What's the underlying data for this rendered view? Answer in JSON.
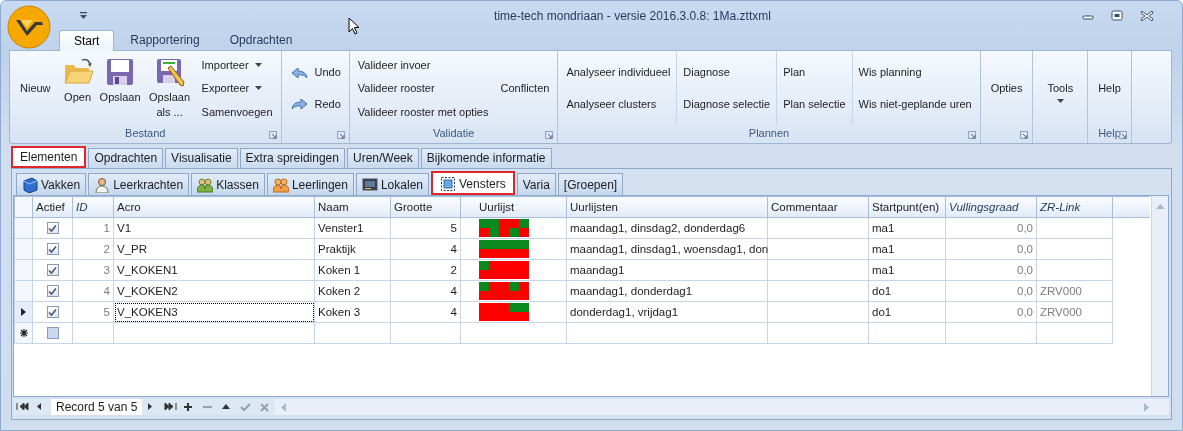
{
  "window": {
    "title": "time-tech mondriaan - versie 2016.3.0.8: 1Ma.zttxml"
  },
  "ribbon_tabs": [
    {
      "label": "Start",
      "selected": true
    },
    {
      "label": "Rapportering",
      "selected": false
    },
    {
      "label": "Opdrachten",
      "selected": false
    }
  ],
  "ribbon_groups": [
    {
      "label": "Bestand",
      "launcher": true,
      "columns": [
        {
          "kind": "text",
          "label": "Nieuw"
        },
        {
          "kind": "large",
          "label": "Open"
        },
        {
          "kind": "large",
          "label": "Opslaan"
        },
        {
          "kind": "large",
          "label": "Opslaan als ..."
        },
        {
          "kind": "stack",
          "items": [
            {
              "label": "Importeer",
              "dropdown": true,
              "icon": false
            },
            {
              "label": "Exporteer",
              "dropdown": true,
              "icon": false
            },
            {
              "label": "Samenvoegen",
              "dropdown": false,
              "icon": false
            }
          ]
        }
      ]
    },
    {
      "launcher": true,
      "columns": [
        {
          "kind": "stack",
          "items": [
            {
              "label": "Undo",
              "dropdown": false,
              "icon": true
            },
            {
              "label": "Redo",
              "dropdown": false,
              "icon": true
            }
          ]
        }
      ]
    },
    {
      "label": "Validatie",
      "launcher": true,
      "columns": [
        {
          "kind": "stack",
          "items": [
            {
              "label": "Valideer invoer",
              "dropdown": false,
              "icon": false
            },
            {
              "label": "Valideer rooster",
              "dropdown": false,
              "icon": false
            },
            {
              "label": "Valideer rooster met opties",
              "dropdown": false,
              "icon": false
            }
          ]
        },
        {
          "kind": "stack",
          "items": [
            {
              "label": "Conflicten",
              "dropdown": false,
              "icon": false
            }
          ]
        }
      ]
    },
    {
      "label": "Plannen",
      "launcher": true,
      "columns": [
        {
          "kind": "stack",
          "items": [
            {
              "label": "Analyseer individueel",
              "dropdown": false,
              "icon": false
            },
            {
              "label": "Analyseer clusters",
              "dropdown": false,
              "icon": false
            }
          ]
        },
        {
          "kind": "divided-stack",
          "items": [
            {
              "label": "Diagnose",
              "dropdown": false,
              "icon": false
            },
            {
              "label": "Diagnose selectie",
              "dropdown": false,
              "icon": false
            }
          ]
        },
        {
          "kind": "divided-stack",
          "items": [
            {
              "label": "Plan",
              "dropdown": false,
              "icon": false
            },
            {
              "label": "Plan selectie",
              "dropdown": false,
              "icon": false
            }
          ]
        },
        {
          "kind": "divided-stack",
          "items": [
            {
              "label": "Wis planning",
              "dropdown": false,
              "icon": false
            },
            {
              "label": "Wis niet-geplande uren",
              "dropdown": false,
              "icon": false
            }
          ]
        }
      ]
    },
    {
      "launcher": true,
      "columns": [
        {
          "kind": "text",
          "label": "Opties"
        }
      ]
    },
    {
      "launcher": false,
      "columns": [
        {
          "kind": "menu",
          "label": "Tools"
        }
      ]
    },
    {
      "label": "Help",
      "launcher": true,
      "columns": [
        {
          "kind": "text",
          "label": "Help"
        }
      ]
    }
  ],
  "main_tabs": [
    {
      "label": "Elementen",
      "selected": true
    },
    {
      "label": "Opdrachten",
      "selected": false
    },
    {
      "label": "Visualisatie",
      "selected": false
    },
    {
      "label": "Extra spreidingen",
      "selected": false
    },
    {
      "label": "Uren/Week",
      "selected": false
    },
    {
      "label": "Bijkomende informatie",
      "selected": false
    }
  ],
  "sub_tabs": [
    {
      "label": "Vakken",
      "selected": false,
      "icon": true
    },
    {
      "label": "Leerkrachten",
      "selected": false,
      "icon": true
    },
    {
      "label": "Klassen",
      "selected": false,
      "icon": true
    },
    {
      "label": "Leerlingen",
      "selected": false,
      "icon": true
    },
    {
      "label": "Lokalen",
      "selected": false,
      "icon": true
    },
    {
      "label": "Vensters",
      "selected": true,
      "icon": true
    },
    {
      "label": "Varia",
      "selected": false,
      "icon": false
    },
    {
      "label": "[Groepen]",
      "selected": false,
      "icon": false
    }
  ],
  "table": {
    "columns": [
      {
        "label": "Actief",
        "kind": "check",
        "readonly": false
      },
      {
        "label": "ID",
        "kind": "number",
        "readonly": true
      },
      {
        "label": "Acro",
        "kind": "text",
        "readonly": false
      },
      {
        "label": "Naam",
        "kind": "text",
        "readonly": false
      },
      {
        "label": "Grootte",
        "kind": "number",
        "readonly": false
      },
      {
        "label": "Uurlijst",
        "kind": "schedule",
        "readonly": false
      },
      {
        "label": "Uurlijsten",
        "kind": "text",
        "readonly": false
      },
      {
        "label": "Commentaar",
        "kind": "text",
        "readonly": false
      },
      {
        "label": "Startpunt(en)",
        "kind": "text",
        "readonly": false
      },
      {
        "label": "Vullingsgraad",
        "kind": "number",
        "readonly": true
      },
      {
        "label": "ZR-Link",
        "kind": "text",
        "readonly": true
      }
    ],
    "rows": [
      {
        "kind": "data",
        "selected": false,
        "cells": [
          true,
          "1",
          "V1",
          "Venster1",
          "5",
          [
            [
              true,
              true,
              true,
              true,
              false,
              false,
              false,
              false,
              true,
              true
            ],
            [
              false,
              false,
              true,
              true,
              false,
              false,
              true,
              true,
              false,
              false
            ]
          ],
          "maandag1, dinsdag2, donderdag6",
          null,
          "ma1",
          "0,0",
          null
        ]
      },
      {
        "kind": "data",
        "selected": false,
        "cells": [
          true,
          "2",
          "V_PR",
          "Praktijk",
          "4",
          [
            [
              true,
              true,
              true,
              true,
              true,
              true,
              true,
              true,
              true,
              true
            ],
            [
              false,
              false,
              false,
              false,
              false,
              false,
              false,
              false,
              false,
              false
            ]
          ],
          "maandag1, dinsdag1, woensdag1, don",
          null,
          "ma1",
          "0,0",
          null
        ]
      },
      {
        "kind": "data",
        "selected": false,
        "cells": [
          true,
          "3",
          "V_KOKEN1",
          "Koken 1",
          "2",
          [
            [
              true,
              true,
              false,
              false,
              false,
              false,
              false,
              false,
              false,
              false
            ],
            [
              false,
              false,
              false,
              false,
              false,
              false,
              false,
              false,
              false,
              false
            ]
          ],
          "maandag1",
          null,
          "ma1",
          "0,0",
          null
        ]
      },
      {
        "kind": "data",
        "selected": false,
        "cells": [
          true,
          "4",
          "V_KOKEN2",
          "Koken 2",
          "4",
          [
            [
              true,
              true,
              false,
              false,
              false,
              false,
              true,
              true,
              false,
              false
            ],
            [
              false,
              false,
              false,
              false,
              false,
              false,
              false,
              false,
              false,
              false
            ]
          ],
          "maandag1, donderdag1",
          null,
          "do1",
          "0,0",
          "ZRV000"
        ]
      },
      {
        "kind": "data",
        "selected": true,
        "cells": [
          true,
          "5",
          "V_KOKEN3",
          "Koken 3",
          "4",
          [
            [
              false,
              false,
              false,
              false,
              false,
              false,
              true,
              true,
              true,
              true
            ],
            [
              false,
              false,
              false,
              false,
              false,
              false,
              false,
              false,
              false,
              false
            ]
          ],
          "donderdag1, vrijdag1",
          null,
          "do1",
          "0,0",
          "ZRV000"
        ]
      },
      {
        "kind": "new",
        "selected": false,
        "cells": [
          false
        ]
      }
    ]
  },
  "navigator": [
    {
      "kind": "first",
      "disabled": false
    },
    {
      "kind": "prev",
      "disabled": false
    },
    {
      "kind": "text",
      "label": "Record 5 van 5"
    },
    {
      "kind": "next",
      "disabled": false
    },
    {
      "kind": "last",
      "disabled": false
    },
    {
      "kind": "append",
      "disabled": false
    },
    {
      "kind": "remove",
      "disabled": true
    },
    {
      "kind": "edit",
      "disabled": false
    },
    {
      "kind": "end-edit",
      "disabled": true
    },
    {
      "kind": "cancel-edit",
      "disabled": true
    }
  ]
}
